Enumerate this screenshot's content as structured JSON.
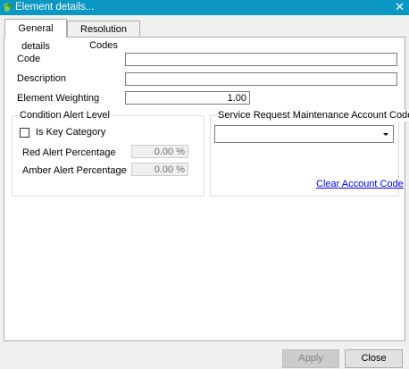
{
  "window": {
    "title": "Element details..."
  },
  "tabs": [
    {
      "label": "General details",
      "active": true
    },
    {
      "label": "Resolution Codes",
      "active": false
    }
  ],
  "form": {
    "code_label": "Code",
    "code_value": "",
    "description_label": "Description",
    "description_value": "",
    "weighting_label": "Element Weighting",
    "weighting_value": "1.00"
  },
  "condition_alert": {
    "title": "Condition Alert Level",
    "is_key_category_label": "Is Key Category",
    "is_key_category_checked": false,
    "red_label": "Red Alert Percentage",
    "red_value": "0.00 %",
    "amber_label": "Amber Alert Percentage",
    "amber_value": "0.00 %"
  },
  "service_request": {
    "title": "Service Request Maintenance Account Code",
    "selected_value": "",
    "clear_link": "Clear Account Code"
  },
  "buttons": {
    "apply": "Apply",
    "close": "Close"
  },
  "colors": {
    "titlebar": "#0b97c4",
    "link": "#0000ee"
  }
}
